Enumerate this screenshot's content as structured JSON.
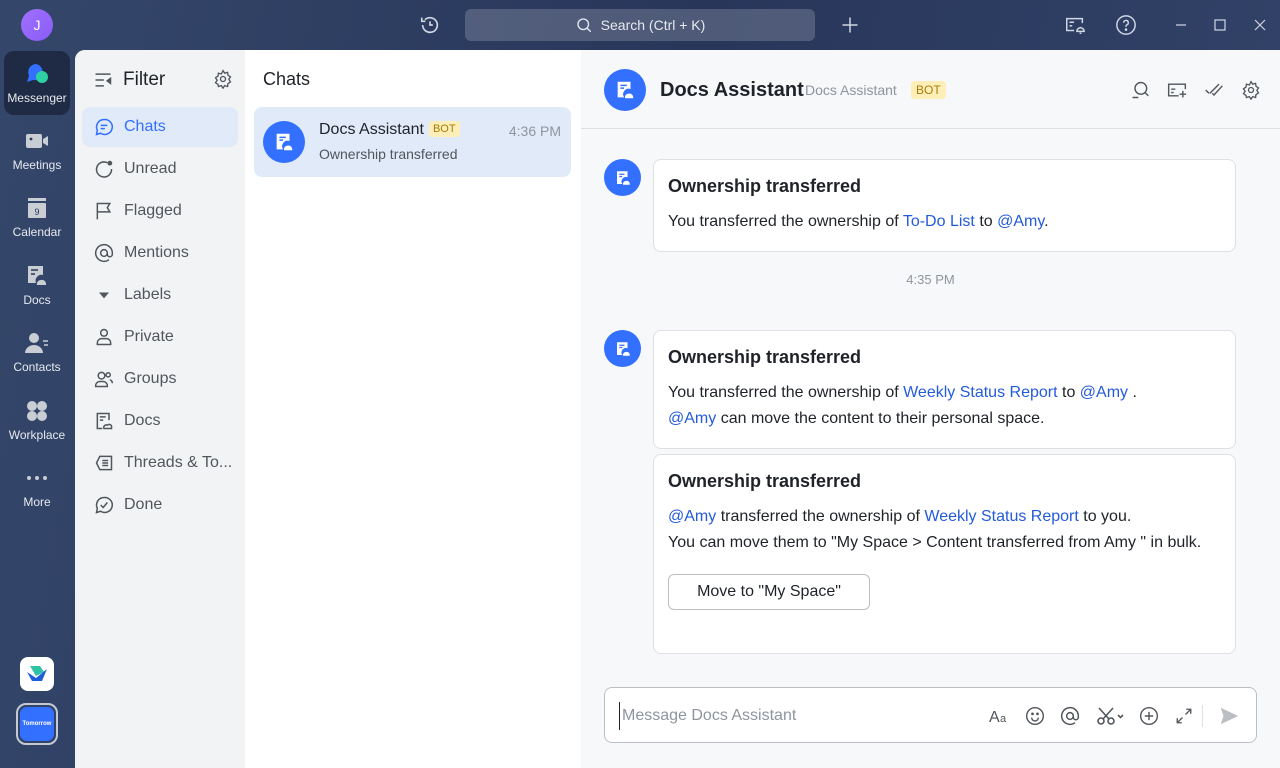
{
  "titlebar": {
    "avatar_initial": "J",
    "search_placeholder": "Search (Ctrl + K)",
    "icons": [
      "history-icon",
      "add-icon",
      "notification-settings-icon",
      "help-icon",
      "minimize-icon",
      "maximize-icon",
      "close-icon"
    ]
  },
  "rail": {
    "items": [
      {
        "label": "Messenger",
        "icon": "messenger-icon",
        "active": true
      },
      {
        "label": "Meetings",
        "icon": "video-camera-icon"
      },
      {
        "label": "Calendar",
        "icon": "calendar-icon",
        "day": "9"
      },
      {
        "label": "Docs",
        "icon": "docs-icon"
      },
      {
        "label": "Contacts",
        "icon": "contacts-icon"
      },
      {
        "label": "Workplace",
        "icon": "workplace-icon"
      },
      {
        "label": "More",
        "icon": "more-icon"
      }
    ],
    "tomorrow_label": "Tomorrow"
  },
  "filter": {
    "title": "Filter",
    "items": [
      {
        "label": "Chats",
        "icon": "chat-bubble-icon",
        "active": true
      },
      {
        "label": "Unread",
        "icon": "unread-icon"
      },
      {
        "label": "Flagged",
        "icon": "flag-icon"
      },
      {
        "label": "Mentions",
        "icon": "at-icon"
      },
      {
        "label": "Labels",
        "icon": "caret-down-icon"
      },
      {
        "label": "Private",
        "icon": "person-icon"
      },
      {
        "label": "Groups",
        "icon": "group-icon"
      },
      {
        "label": "Docs",
        "icon": "docs-icon"
      },
      {
        "label": "Threads & To...",
        "icon": "threads-icon"
      },
      {
        "label": "Done",
        "icon": "done-icon"
      }
    ]
  },
  "chats": {
    "title": "Chats",
    "items": [
      {
        "name": "Docs Assistant",
        "badge": "BOT",
        "time": "4:36 PM",
        "preview": "Ownership transferred"
      }
    ]
  },
  "conversation": {
    "name": "Docs Assistant",
    "subtitle": "Docs Assistant",
    "badge": "BOT",
    "messages": [
      {
        "title": "Ownership transferred",
        "text_1": "You transferred the ownership of ",
        "doc": "To-Do List",
        "text_2": " to ",
        "mention": "@Amy",
        "text_3": "."
      },
      {
        "title": "Ownership transferred",
        "text_1": "You transferred the ownership of ",
        "doc": "Weekly Status Report",
        "text_2": " to ",
        "mention": "@Amy",
        "text_3": " .",
        "mention_2": "@Amy",
        "text_4": " can move the content to their personal space."
      },
      {
        "title": "Ownership transferred",
        "mention": "@Amy",
        "text_1": " transferred the ownership of ",
        "doc": "Weekly Status Report",
        "text_2": " to you.",
        "text_3": "You can move them to \"My Space > Content transferred from Amy \" in bulk.",
        "button": "Move to \"My Space\""
      }
    ],
    "timestamp": "4:35 PM",
    "composer_placeholder": "Message Docs Assistant"
  }
}
